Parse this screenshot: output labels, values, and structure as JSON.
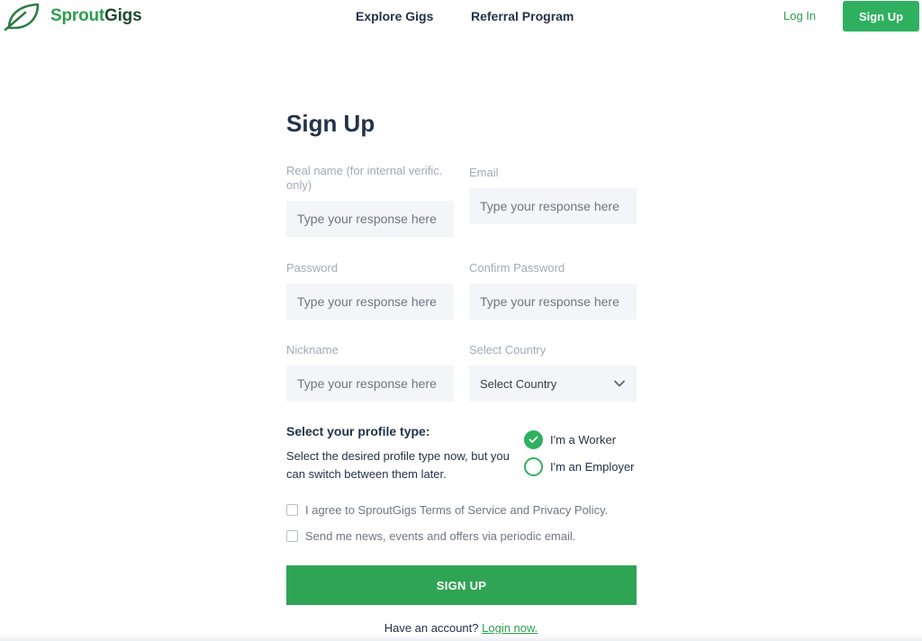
{
  "header": {
    "brand_part1": "Sprout",
    "brand_part2": "Gigs",
    "nav": [
      "Explore Gigs",
      "Referral Program"
    ],
    "login_label": "Log In",
    "signup_label": "Sign Up"
  },
  "form": {
    "title": "Sign Up",
    "fields": {
      "real_name": {
        "label": "Real name (for internal verific. only)",
        "placeholder": "Type your response here"
      },
      "email": {
        "label": "Email",
        "placeholder": "Type your response here"
      },
      "password": {
        "label": "Password",
        "placeholder": "Type your response here"
      },
      "confirm_password": {
        "label": "Confirm Password",
        "placeholder": "Type your response here"
      },
      "nickname": {
        "label": "Nickname",
        "placeholder": "Type your response here"
      },
      "country": {
        "label": "Select Country",
        "value": "Select Country"
      }
    },
    "profile": {
      "title": "Select your profile type:",
      "description": "Select the desired profile type now, but you can switch between them later.",
      "options": [
        {
          "label": "I'm a Worker",
          "selected": true
        },
        {
          "label": "I'm an Employer",
          "selected": false
        }
      ]
    },
    "checkboxes": [
      {
        "label": "I agree to SproutGigs Terms of Service and Privacy Policy.",
        "checked": false
      },
      {
        "label": "Send me news, events and offers via periodic email.",
        "checked": false
      }
    ],
    "submit_label": "SIGN UP",
    "footer_text": "Have an account?",
    "footer_link": "Login now."
  },
  "colors": {
    "brand_green": "#2fb060",
    "dark_text": "#23324a",
    "field_bg": "#f4f5f8"
  },
  "icons": {
    "logo": "leaf-logo-icon",
    "country_dropdown": "chevron-down-icon",
    "worker_radio": "checkmark-icon"
  }
}
